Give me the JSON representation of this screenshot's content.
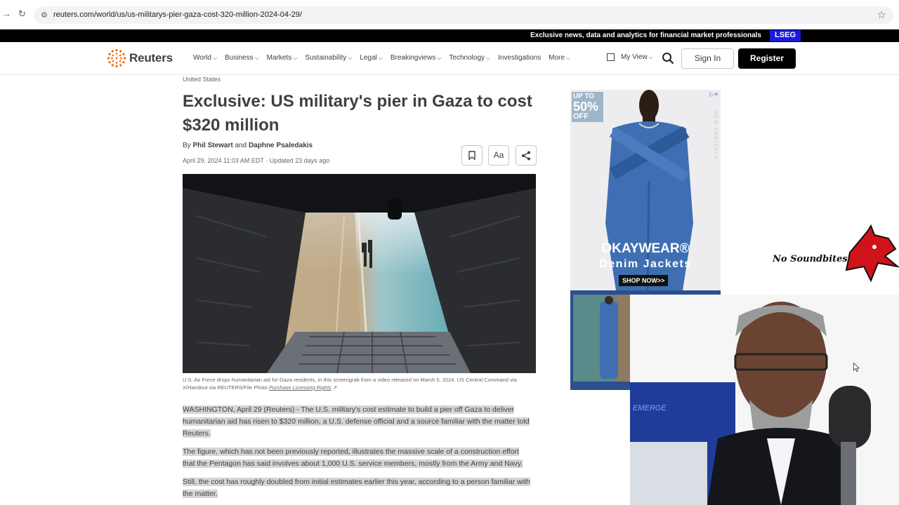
{
  "browser": {
    "url": "reuters.com/world/us/us-militarys-pier-gaza-cost-320-million-2024-04-29/"
  },
  "promo_strip": {
    "text": "Exclusive news, data and analytics for financial market professionals",
    "brand": "LSEG"
  },
  "header": {
    "logo_text": "Reuters",
    "menu": [
      "World",
      "Business",
      "Markets",
      "Sustainability",
      "Legal",
      "Breakingviews",
      "Technology",
      "Investigations",
      "More"
    ],
    "menu_with_chevron": [
      true,
      true,
      true,
      true,
      true,
      true,
      true,
      false,
      true
    ],
    "my_view": "My View",
    "sign_in": "Sign In",
    "register": "Register"
  },
  "article": {
    "eyebrow": "United States",
    "headline": "Exclusive: US military's pier in Gaza to cost $320 million",
    "byline_prefix": "By",
    "author1": "Phil Stewart",
    "byline_and": "and",
    "author2": "Daphne Psaledakis",
    "dateline": "April 29, 2024 11:03 AM EDT · Updated 23 days ago",
    "tools": {
      "text_size": "Aa"
    },
    "caption": "U.S. Air Force drops humanitarian aid for Gaza residents, in this screengrab from a video released on March 5, 2024. US Central Command via X/Handout via REUTERS/File Photo",
    "caption_rights": "Purchase Licensing Rights",
    "paragraphs": [
      "WASHINGTON, April 29 (Reuters) - The U.S. military's cost estimate to build a pier off Gaza to deliver humanitarian aid has risen to $320 million, a U.S. defense official and a source familiar with the matter told Reuters.",
      "The figure, which has not been previously reported, illustrates the massive scale of a construction effort that the Pentagon has said involves about 1,000 U.S. service members, mostly from the Army and Navy.",
      "Still, the cost has roughly doubled from initial estimates earlier this year, according to a person familiar with the matter."
    ]
  },
  "ad": {
    "badge_line1": "UP TO",
    "badge_line2": "50%",
    "badge_line3": "OFF",
    "brand": "OKAYWEAR®",
    "subtitle": "Denim Jackets",
    "cta": "SHOP NOW>>",
    "side_text": "NEW ARRIVALS"
  },
  "overlay": {
    "watermark": "No Soundbites",
    "chair_brand": "EMERGE"
  },
  "colors": {
    "promo_bg": "#000000",
    "lseg_blue": "#1a1adf",
    "register_bg": "#000000",
    "highlight": "#d6d6d6",
    "ad_denim": "#2b4f8f",
    "logo_orange": "#fa6400"
  }
}
